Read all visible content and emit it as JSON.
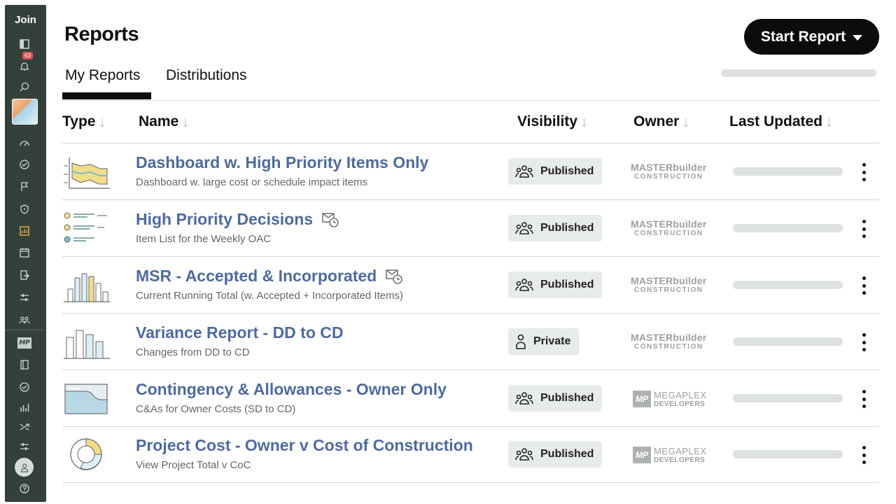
{
  "sidebar": {
    "title": "Join",
    "notification_count": "63",
    "icons": [
      "panel-icon",
      "bell-icon",
      "search-icon",
      "gauge-icon",
      "check-circle-icon",
      "flag-icon",
      "shield-icon",
      "report-icon",
      "calendar-icon",
      "transfer-icon",
      "sliders-icon",
      "team-icon",
      "book-icon",
      "check-badge-icon",
      "bar-chart-icon",
      "shuffle-icon",
      "sliders-icon",
      "help-icon"
    ],
    "company_badge": "MP"
  },
  "header": {
    "title": "Reports",
    "start_button": "Start Report",
    "tabs": [
      {
        "label": "My Reports",
        "active": true
      },
      {
        "label": "Distributions",
        "active": false
      }
    ]
  },
  "table": {
    "columns": [
      "Type",
      "Name",
      "Visibility",
      "Owner",
      "Last Updated"
    ],
    "rows": [
      {
        "title": "Dashboard w. High Priority Items Only",
        "subtitle": "Dashboard w. large cost or schedule impact items",
        "visibility": "Published",
        "owner": {
          "l1": "MASTERbuilder",
          "l2": "CONSTRUCTION"
        },
        "icon": "dashboard-icon",
        "scheduled": false
      },
      {
        "title": "High Priority Decisions",
        "subtitle": "Item List for the Weekly OAC",
        "visibility": "Published",
        "owner": {
          "l1": "MASTERbuilder",
          "l2": "CONSTRUCTION"
        },
        "icon": "item-list-icon",
        "scheduled": true
      },
      {
        "title": "MSR - Accepted & Incorporated",
        "subtitle": "Current Running Total (w. Accepted + Incorporated Items)",
        "visibility": "Published",
        "owner": {
          "l1": "MASTERbuilder",
          "l2": "CONSTRUCTION"
        },
        "icon": "bar-chart-icon",
        "scheduled": true
      },
      {
        "title": "Variance Report - DD to CD",
        "subtitle": "Changes from DD to CD",
        "visibility": "Private",
        "owner": {
          "l1": "MASTERbuilder",
          "l2": "CONSTRUCTION"
        },
        "icon": "bar-chart-icon",
        "scheduled": false
      },
      {
        "title": "Contingency & Allowances - Owner Only",
        "subtitle": "C&As for Owner Costs (SD to CD)",
        "visibility": "Published",
        "owner": {
          "logo": "MP",
          "l1": "MEGAPLEX",
          "l2": "DEVELOPERS"
        },
        "icon": "area-chart-icon",
        "scheduled": false
      },
      {
        "title": "Project Cost - Owner v Cost of Construction",
        "subtitle": "View Project Total v CoC",
        "visibility": "Published",
        "owner": {
          "logo": "MP",
          "l1": "MEGAPLEX",
          "l2": "DEVELOPERS"
        },
        "icon": "donut-chart-icon",
        "scheduled": false
      }
    ]
  },
  "colors": {
    "sidebar": "#34413b",
    "link": "#4e6b9c",
    "badge": "#d9534f"
  }
}
